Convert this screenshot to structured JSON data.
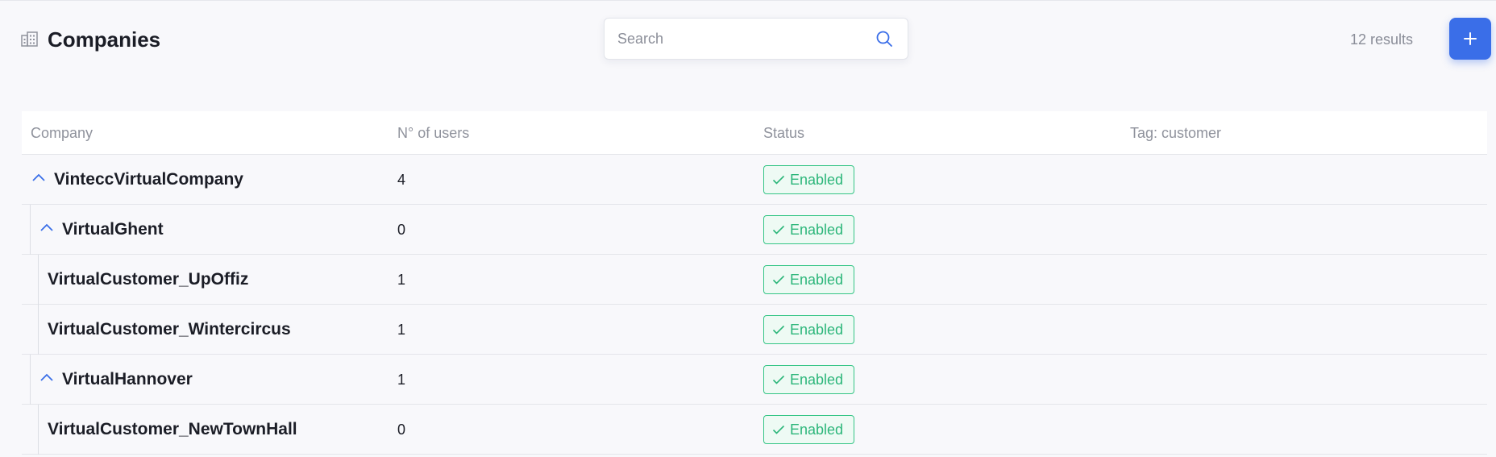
{
  "header": {
    "title": "Companies",
    "page_icon": "building-icon",
    "search": {
      "placeholder": "Search",
      "value": "",
      "icon": "search-icon"
    },
    "results": "12 results",
    "add_icon": "plus-icon"
  },
  "colors": {
    "accent": "#3a6ee8",
    "status_green": "#2cb67a",
    "status_bg": "#eefaf4",
    "text": "#1b1d26",
    "muted": "#8a8d98"
  },
  "table": {
    "columns": [
      "Company",
      "N° of users",
      "Status",
      "Tag: customer"
    ],
    "rows": [
      {
        "name": "VinteccVirtualCompany",
        "users": "4",
        "status": "Enabled",
        "tag": "",
        "level": 0,
        "expandable": true
      },
      {
        "name": "VirtualGhent",
        "users": "0",
        "status": "Enabled",
        "tag": "",
        "level": 1,
        "expandable": true
      },
      {
        "name": "VirtualCustomer_UpOffiz",
        "users": "1",
        "status": "Enabled",
        "tag": "",
        "level": 2,
        "expandable": false
      },
      {
        "name": "VirtualCustomer_Wintercircus",
        "users": "1",
        "status": "Enabled",
        "tag": "",
        "level": 2,
        "expandable": false
      },
      {
        "name": "VirtualHannover",
        "users": "1",
        "status": "Enabled",
        "tag": "",
        "level": 1,
        "expandable": true
      },
      {
        "name": "VirtualCustomer_NewTownHall",
        "users": "0",
        "status": "Enabled",
        "tag": "",
        "level": 2,
        "expandable": false
      }
    ]
  }
}
